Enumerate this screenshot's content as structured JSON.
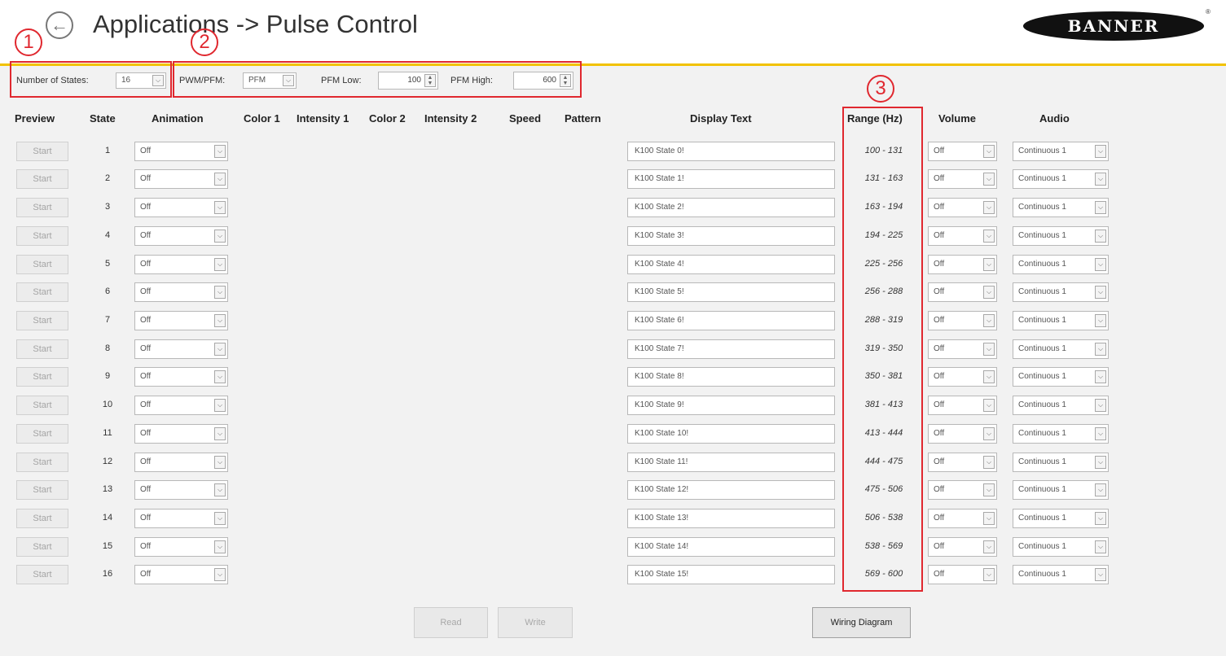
{
  "header": {
    "title": "Applications -> Pulse Control",
    "logo_text": "BANNER",
    "logo_mark": "®"
  },
  "callouts": [
    "1",
    "2",
    "3"
  ],
  "toolbar": {
    "num_states_label": "Number of States:",
    "num_states_value": "16",
    "mode_label": "PWM/PFM:",
    "mode_value": "PFM",
    "pfm_low_label": "PFM Low:",
    "pfm_low_value": "100",
    "pfm_high_label": "PFM High:",
    "pfm_high_value": "600"
  },
  "columns": {
    "preview": "Preview",
    "state": "State",
    "animation": "Animation",
    "color1": "Color 1",
    "intensity1": "Intensity 1",
    "color2": "Color 2",
    "intensity2": "Intensity 2",
    "speed": "Speed",
    "pattern": "Pattern",
    "display_text": "Display Text",
    "range": "Range (Hz)",
    "volume": "Volume",
    "audio": "Audio"
  },
  "rows": [
    {
      "state": "1",
      "start": "Start",
      "animation": "Off",
      "display_text": "K100 State 0!",
      "range": "100 - 131",
      "volume": "Off",
      "audio": "Continuous 1"
    },
    {
      "state": "2",
      "start": "Start",
      "animation": "Off",
      "display_text": "K100 State 1!",
      "range": "131 - 163",
      "volume": "Off",
      "audio": "Continuous 1"
    },
    {
      "state": "3",
      "start": "Start",
      "animation": "Off",
      "display_text": "K100 State 2!",
      "range": "163 - 194",
      "volume": "Off",
      "audio": "Continuous 1"
    },
    {
      "state": "4",
      "start": "Start",
      "animation": "Off",
      "display_text": "K100 State 3!",
      "range": "194 - 225",
      "volume": "Off",
      "audio": "Continuous 1"
    },
    {
      "state": "5",
      "start": "Start",
      "animation": "Off",
      "display_text": "K100 State 4!",
      "range": "225 - 256",
      "volume": "Off",
      "audio": "Continuous 1"
    },
    {
      "state": "6",
      "start": "Start",
      "animation": "Off",
      "display_text": "K100 State 5!",
      "range": "256 - 288",
      "volume": "Off",
      "audio": "Continuous 1"
    },
    {
      "state": "7",
      "start": "Start",
      "animation": "Off",
      "display_text": "K100 State 6!",
      "range": "288 - 319",
      "volume": "Off",
      "audio": "Continuous 1"
    },
    {
      "state": "8",
      "start": "Start",
      "animation": "Off",
      "display_text": "K100 State 7!",
      "range": "319 - 350",
      "volume": "Off",
      "audio": "Continuous 1"
    },
    {
      "state": "9",
      "start": "Start",
      "animation": "Off",
      "display_text": "K100 State 8!",
      "range": "350 - 381",
      "volume": "Off",
      "audio": "Continuous 1"
    },
    {
      "state": "10",
      "start": "Start",
      "animation": "Off",
      "display_text": "K100 State 9!",
      "range": "381 - 413",
      "volume": "Off",
      "audio": "Continuous 1"
    },
    {
      "state": "11",
      "start": "Start",
      "animation": "Off",
      "display_text": "K100 State 10!",
      "range": "413 - 444",
      "volume": "Off",
      "audio": "Continuous 1"
    },
    {
      "state": "12",
      "start": "Start",
      "animation": "Off",
      "display_text": "K100 State 11!",
      "range": "444 - 475",
      "volume": "Off",
      "audio": "Continuous 1"
    },
    {
      "state": "13",
      "start": "Start",
      "animation": "Off",
      "display_text": "K100 State 12!",
      "range": "475 - 506",
      "volume": "Off",
      "audio": "Continuous 1"
    },
    {
      "state": "14",
      "start": "Start",
      "animation": "Off",
      "display_text": "K100 State 13!",
      "range": "506 - 538",
      "volume": "Off",
      "audio": "Continuous 1"
    },
    {
      "state": "15",
      "start": "Start",
      "animation": "Off",
      "display_text": "K100 State 14!",
      "range": "538 - 569",
      "volume": "Off",
      "audio": "Continuous 1"
    },
    {
      "state": "16",
      "start": "Start",
      "animation": "Off",
      "display_text": "K100 State 15!",
      "range": "569 - 600",
      "volume": "Off",
      "audio": "Continuous 1"
    }
  ],
  "footer": {
    "read_label": "Read",
    "write_label": "Write",
    "wiring_label": "Wiring Diagram"
  },
  "icons": {
    "back": "back-arrow-icon",
    "dropdown": "chevron-down-icon",
    "spinner": "spinner-icon"
  },
  "colors": {
    "accent": "#f2c200",
    "callout": "#e0282f",
    "background": "#f2f2f2"
  }
}
